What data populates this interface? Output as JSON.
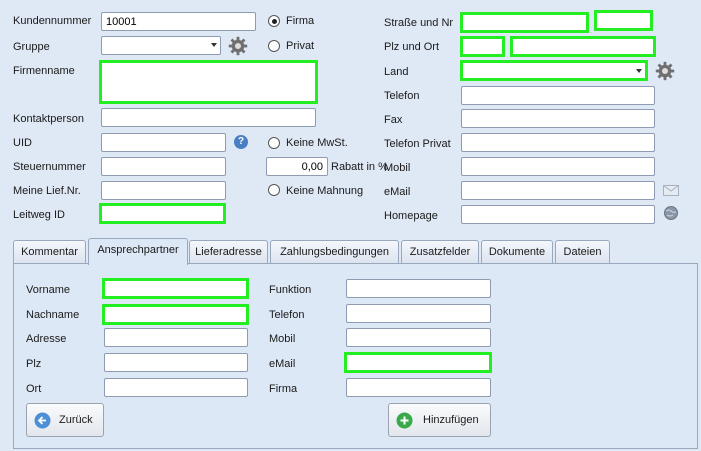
{
  "header": {
    "kundennummer_label": "Kundennummer",
    "kundennummer_value": "10001",
    "gruppe_label": "Gruppe",
    "firmenname_label": "Firmenname",
    "kontaktperson_label": "Kontaktperson",
    "uid_label": "UID",
    "steuernummer_label": "Steuernummer",
    "lief_nr_label": "Meine Lief.Nr.",
    "leitweg_label": "Leitweg ID",
    "radio_firma": "Firma",
    "radio_privat": "Privat",
    "keine_mwst": "Keine MwSt.",
    "rabatt_value": "0,00",
    "rabatt_label": "Rabatt in %",
    "keine_mahnung": "Keine Mahnung",
    "strasse_label": "Straße und Nr",
    "plz_ort_label": "Plz und Ort",
    "land_label": "Land",
    "telefon_label": "Telefon",
    "fax_label": "Fax",
    "telefon_privat_label": "Telefon Privat",
    "mobil_label": "Mobil",
    "email_label": "eMail",
    "homepage_label": "Homepage",
    "help_glyph": "?"
  },
  "tabs": [
    "Kommentar",
    "Ansprechpartner",
    "Lieferadresse",
    "Zahlungsbedingungen",
    "Zusatzfelder",
    "Dokumente",
    "Dateien"
  ],
  "active_tab": "Ansprechpartner",
  "contact": {
    "vorname_label": "Vorname",
    "nachname_label": "Nachname",
    "adresse_label": "Adresse",
    "plz_label": "Plz",
    "ort_label": "Ort",
    "funktion_label": "Funktion",
    "telefon_label": "Telefon",
    "mobil_label": "Mobil",
    "email_label": "eMail",
    "firma_label": "Firma",
    "back_button": "Zurück",
    "add_button": "Hinzufügen"
  },
  "colors": {
    "highlight": "#22ee22",
    "background": "#dfe8f5",
    "back_icon": "#4d8fd6",
    "add_icon": "#3aa94a"
  }
}
